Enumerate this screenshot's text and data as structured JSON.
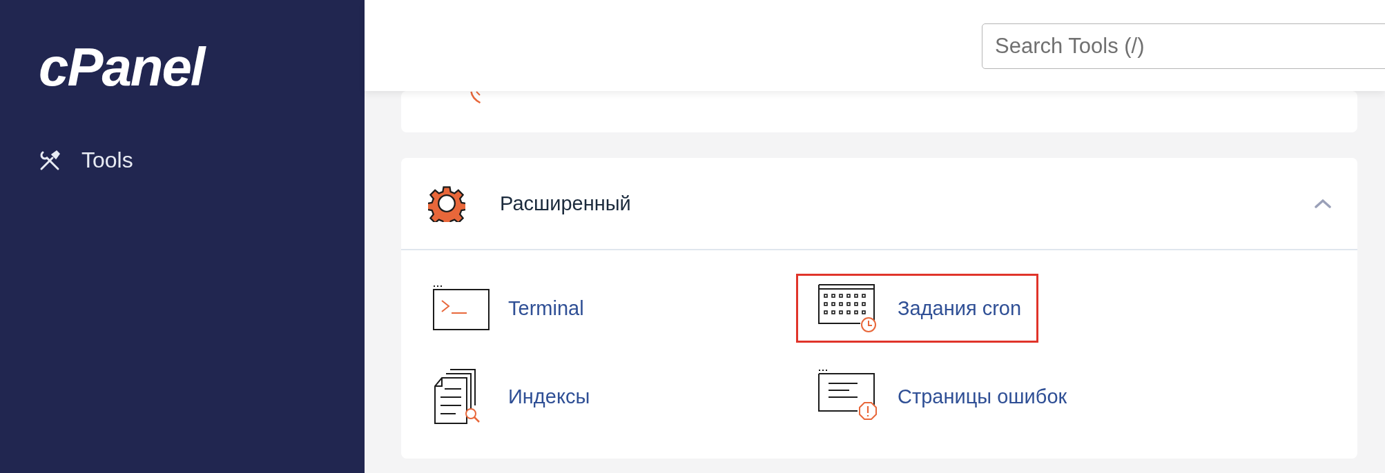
{
  "sidebar": {
    "logo": "cPanel",
    "items": [
      {
        "label": "Tools",
        "selected": false
      }
    ]
  },
  "search": {
    "placeholder": "Search Tools (/)"
  },
  "section": {
    "title": "Расширенный",
    "expanded": true,
    "items": [
      {
        "label": "Terminal",
        "kind": "terminal",
        "highlighted": false
      },
      {
        "label": "Задания cron",
        "kind": "cron",
        "highlighted": true
      },
      {
        "label": "Индексы",
        "kind": "indexes",
        "highlighted": false
      },
      {
        "label": "Страницы ошибок",
        "kind": "errors",
        "highlighted": false
      }
    ]
  }
}
